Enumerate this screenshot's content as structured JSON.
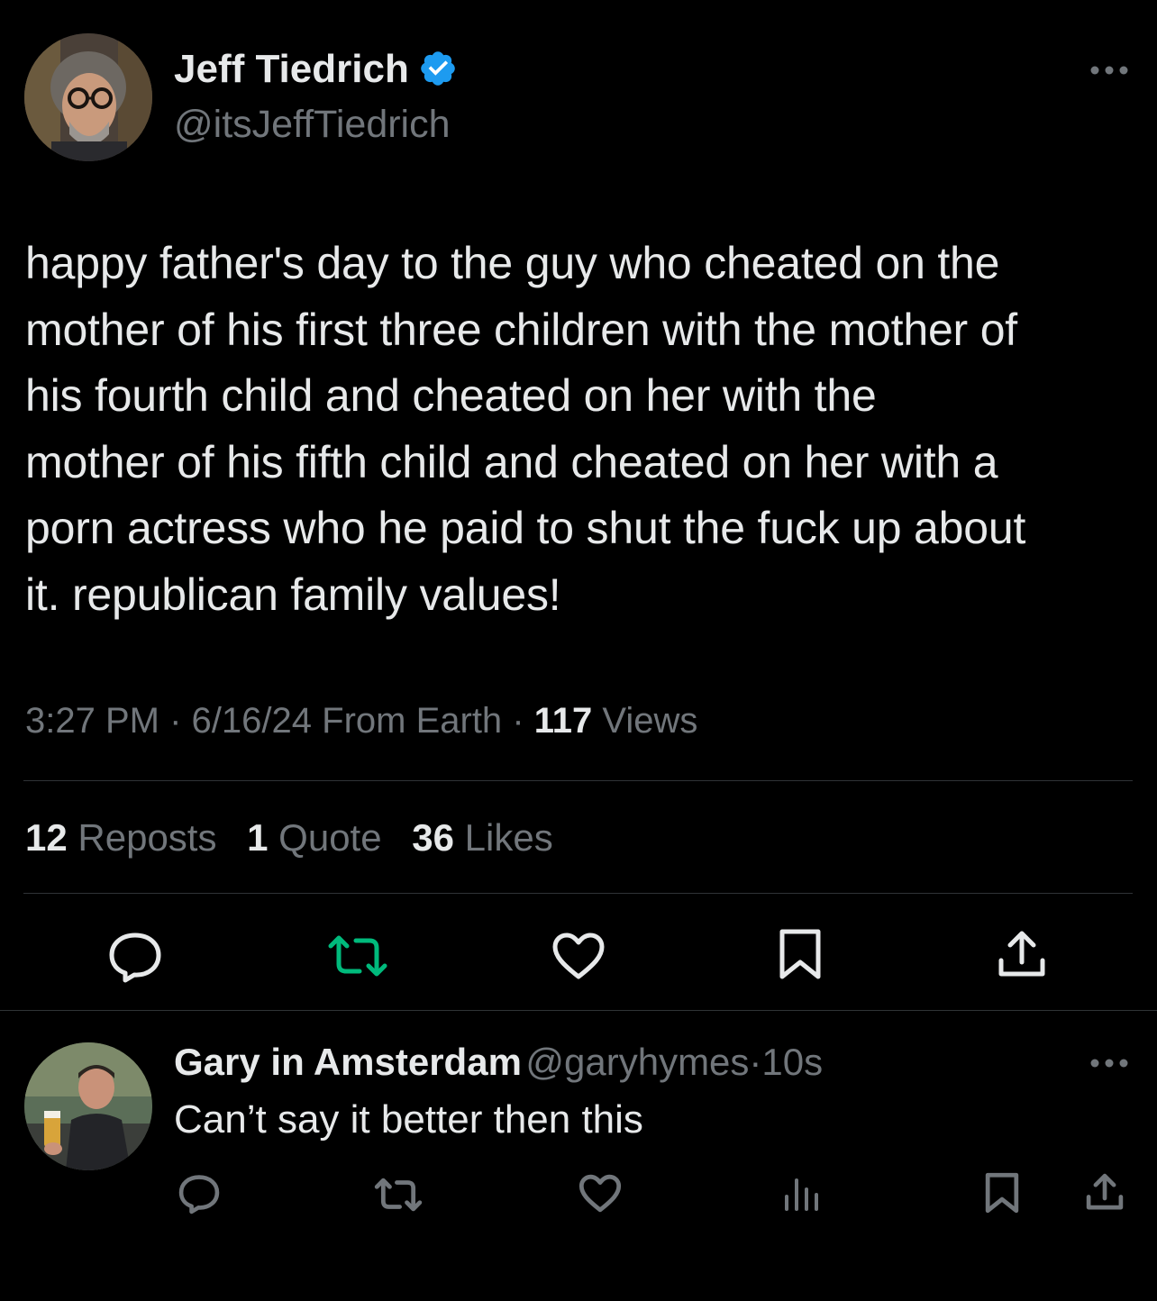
{
  "tweet": {
    "author_name": "Jeff Tiedrich",
    "author_handle": "@itsJeffTiedrich",
    "text_lines": [
      "happy father's day to the guy who cheated on the",
      "mother of his first three children with the mother of",
      "his fourth child and cheated on her with the",
      "mother of his fifth child and cheated on her with a",
      "porn actress who he paid to shut the fuck up about",
      "it. republican family values!"
    ],
    "time": "3:27 PM",
    "dot": "·",
    "date": "6/16/24",
    "source": "From Earth",
    "views_count": "117",
    "views_label": "Views",
    "stats": {
      "reposts_count": "12",
      "reposts_label": "Reposts",
      "quotes_count": "1",
      "quotes_label": "Quote",
      "likes_count": "36",
      "likes_label": "Likes"
    },
    "icons": [
      "more-icon",
      "verified-badge-icon",
      "reply-icon",
      "repost-icon",
      "like-icon",
      "bookmark-icon",
      "share-icon"
    ]
  },
  "reply": {
    "author_name": "Gary in Amsterdam",
    "author_handle": "@garyhymes",
    "dot": "·",
    "age": "10s",
    "text": "Can’t say it better then this",
    "icons": [
      "more-icon",
      "reply-icon",
      "repost-icon",
      "like-icon",
      "views-icon",
      "bookmark-icon",
      "share-icon"
    ]
  },
  "colors": {
    "background": "#000000",
    "text_primary": "#e7e9ea",
    "text_secondary": "#71767b",
    "divider": "#2f3336",
    "verified_blue": "#1d9bf0",
    "repost_green": "#00ba7c"
  }
}
